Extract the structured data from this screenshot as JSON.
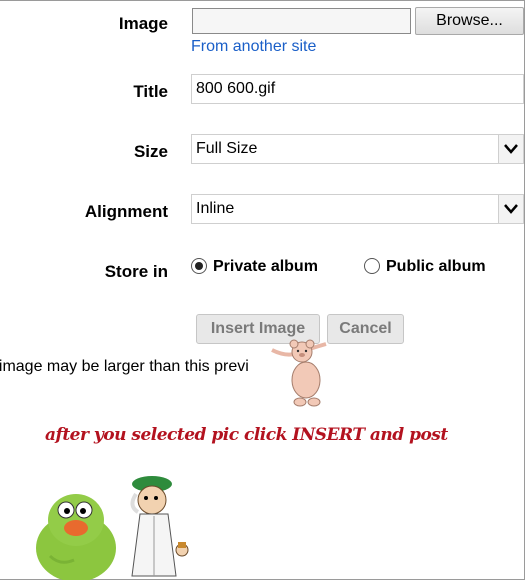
{
  "form": {
    "image": {
      "label": "Image",
      "browse_label": "Browse...",
      "alt_link": "From another site"
    },
    "title": {
      "label": "Title",
      "value": "800 600.gif"
    },
    "size": {
      "label": "Size",
      "selected": "Full Size"
    },
    "alignment": {
      "label": "Alignment",
      "selected": "Inline"
    },
    "store_in": {
      "label": "Store in",
      "options": [
        {
          "label": "Private album",
          "checked": true
        },
        {
          "label": "Public album",
          "checked": false
        }
      ]
    },
    "buttons": {
      "insert": "Insert Image",
      "cancel": "Cancel"
    },
    "note": "al image may be larger than this previ"
  },
  "annotation": {
    "instruction": "after you selected pic click INSERT and post"
  },
  "icons": {
    "dropdown": "chevron-down-icon",
    "bear": "bear-sticker",
    "monster": "green-monster-sticker",
    "scientist": "scientist-sticker"
  },
  "colors": {
    "link": "#1a5fc8",
    "instruction": "#b3121f"
  }
}
